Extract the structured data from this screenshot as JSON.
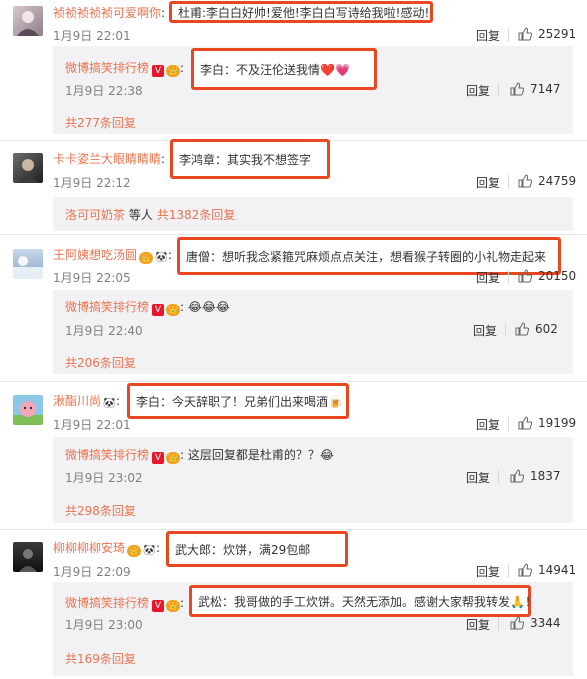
{
  "comments": [
    {
      "username": "祯祯祯祯祯可爱啊你",
      "text": "杜甫:李白白好帅!爱他!李白白写诗给我啦!感动!",
      "time": "1月9日 22:01",
      "reply_label": "回复",
      "likes": "25291",
      "sub": {
        "username": "微博搞笑排行榜",
        "text": "李白：不及汪伦送我情❤️💗",
        "time": "1月9日 22:38",
        "reply_label": "回复",
        "likes": "7147",
        "more": "共277条回复"
      }
    },
    {
      "username": "卡卡姿兰大眼睛睛睛",
      "text": "李鸿章：其实我不想签字",
      "time": "1月9日 22:12",
      "reply_label": "回复",
      "likes": "24759",
      "sub": {
        "user": "洛可可奶茶",
        "suffix": "等人",
        "more": "共1382条回复"
      }
    },
    {
      "username": "王阿姨想吃汤圆",
      "text": "唐僧：想听我念紧箍咒麻烦点点关注，想看猴子转圈的小礼物走起来",
      "time": "1月9日 22:05",
      "reply_label": "回复",
      "likes": "20150",
      "sub": {
        "username": "微博搞笑排行榜",
        "text": "😂😂😂",
        "time": "1月9日 22:40",
        "reply_label": "回复",
        "likes": "602",
        "more": "共206条回复"
      }
    },
    {
      "username": "湫酯川尚",
      "text": "李白：今天辞职了！兄弟们出来喝酒🍺",
      "time": "1月9日 22:01",
      "reply_label": "回复",
      "likes": "19199",
      "sub": {
        "username": "微博搞笑排行榜",
        "text": "这层回复都是杜甫的？？😂",
        "time": "1月9日 23:02",
        "reply_label": "回复",
        "likes": "1837",
        "more": "共298条回复"
      }
    },
    {
      "username": "柳柳柳柳安琦",
      "text": "武大郎：炊饼，满29包邮",
      "time": "1月9日 22:09",
      "reply_label": "回复",
      "likes": "14941",
      "sub": {
        "username": "微博搞笑排行榜",
        "text": "武松：我哥做的手工炊饼。天然无添加。感谢大家帮我转发🙏！",
        "time": "1月9日 23:00",
        "reply_label": "回复",
        "likes": "3344",
        "more": "共169条回复"
      }
    }
  ],
  "badges": {
    "vip": "V",
    "mini": "会员",
    "panda": "🐼"
  },
  "colors": {
    "accent": "#eb7350",
    "highlight_border": "#e8471f",
    "sub_bg": "#f2f2f5"
  }
}
